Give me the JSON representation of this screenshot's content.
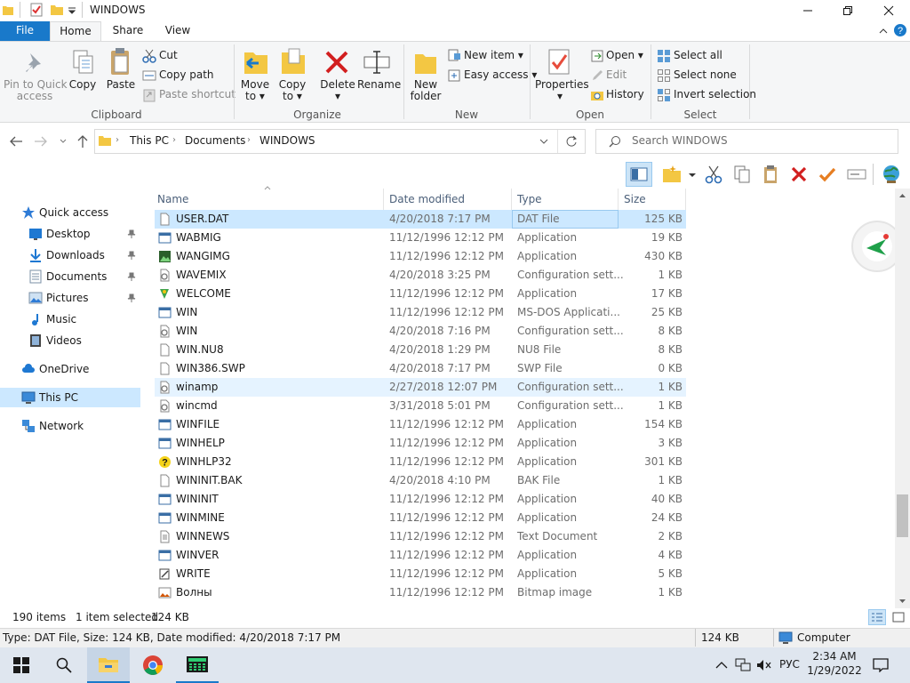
{
  "window": {
    "title": "WINDOWS"
  },
  "tabs": {
    "file": "File",
    "home": "Home",
    "share": "Share",
    "view": "View"
  },
  "ribbon": {
    "pin_line1": "Pin to Quick",
    "pin_line2": "access",
    "copy": "Copy",
    "paste": "Paste",
    "cut": "Cut",
    "copy_path": "Copy path",
    "paste_shortcut": "Paste shortcut",
    "clipboard": "Clipboard",
    "move_line1": "Move",
    "move_line2": "to",
    "copy_to_line1": "Copy",
    "copy_to_line2": "to",
    "delete": "Delete",
    "rename": "Rename",
    "organize": "Organize",
    "new_folder_line1": "New",
    "new_folder_line2": "folder",
    "new_item": "New item",
    "easy_access": "Easy access",
    "new": "New",
    "properties": "Properties",
    "open": "Open",
    "edit": "Edit",
    "history": "History",
    "open_group": "Open",
    "select_all": "Select all",
    "select_none": "Select none",
    "invert_selection": "Invert selection",
    "select_group": "Select"
  },
  "address": {
    "crumbs": [
      "This PC",
      "Documents",
      "WINDOWS"
    ],
    "search_placeholder": "Search WINDOWS"
  },
  "nav": {
    "quick_access": "Quick access",
    "desktop": "Desktop",
    "downloads": "Downloads",
    "documents": "Documents",
    "pictures": "Pictures",
    "music": "Music",
    "videos": "Videos",
    "onedrive": "OneDrive",
    "this_pc": "This PC",
    "network": "Network"
  },
  "columns": {
    "name": "Name",
    "date": "Date modified",
    "type": "Type",
    "size": "Size"
  },
  "files": [
    {
      "name": "USER.DAT",
      "date": "4/20/2018 7:17 PM",
      "type": "DAT File",
      "size": "125 KB",
      "icon": "blank-file-icon",
      "state": "selected"
    },
    {
      "name": "WABMIG",
      "date": "11/12/1996 12:12 PM",
      "type": "Application",
      "size": "19 KB",
      "icon": "app-icon",
      "state": ""
    },
    {
      "name": "WANGIMG",
      "date": "11/12/1996 12:12 PM",
      "type": "Application",
      "size": "430 KB",
      "icon": "image-app-icon",
      "state": ""
    },
    {
      "name": "WAVEMIX",
      "date": "4/20/2018 3:25 PM",
      "type": "Configuration sett...",
      "size": "1 KB",
      "icon": "config-file-icon",
      "state": ""
    },
    {
      "name": "WELCOME",
      "date": "11/12/1996 12:12 PM",
      "type": "Application",
      "size": "17 KB",
      "icon": "welcome-app-icon",
      "state": ""
    },
    {
      "name": "WIN",
      "date": "11/12/1996 12:12 PM",
      "type": "MS-DOS Applicati...",
      "size": "25 KB",
      "icon": "app-icon",
      "state": ""
    },
    {
      "name": "WIN",
      "date": "4/20/2018 7:16 PM",
      "type": "Configuration sett...",
      "size": "8 KB",
      "icon": "config-file-icon",
      "state": ""
    },
    {
      "name": "WIN.NU8",
      "date": "4/20/2018 1:29 PM",
      "type": "NU8 File",
      "size": "8 KB",
      "icon": "blank-file-icon",
      "state": ""
    },
    {
      "name": "WIN386.SWP",
      "date": "4/20/2018 7:17 PM",
      "type": "SWP File",
      "size": "0 KB",
      "icon": "blank-file-icon",
      "state": ""
    },
    {
      "name": "winamp",
      "date": "2/27/2018 12:07 PM",
      "type": "Configuration sett...",
      "size": "1 KB",
      "icon": "config-file-icon",
      "state": "hover"
    },
    {
      "name": "wincmd",
      "date": "3/31/2018 5:01 PM",
      "type": "Configuration sett...",
      "size": "1 KB",
      "icon": "config-file-icon",
      "state": ""
    },
    {
      "name": "WINFILE",
      "date": "11/12/1996 12:12 PM",
      "type": "Application",
      "size": "154 KB",
      "icon": "app-icon",
      "state": ""
    },
    {
      "name": "WINHELP",
      "date": "11/12/1996 12:12 PM",
      "type": "Application",
      "size": "3 KB",
      "icon": "app-icon",
      "state": ""
    },
    {
      "name": "WINHLP32",
      "date": "11/12/1996 12:12 PM",
      "type": "Application",
      "size": "301 KB",
      "icon": "help-app-icon",
      "state": ""
    },
    {
      "name": "WININIT.BAK",
      "date": "4/20/2018 4:10 PM",
      "type": "BAK File",
      "size": "1 KB",
      "icon": "blank-file-icon",
      "state": ""
    },
    {
      "name": "WININIT",
      "date": "11/12/1996 12:12 PM",
      "type": "Application",
      "size": "40 KB",
      "icon": "app-icon",
      "state": ""
    },
    {
      "name": "WINMINE",
      "date": "11/12/1996 12:12 PM",
      "type": "Application",
      "size": "24 KB",
      "icon": "app-icon",
      "state": ""
    },
    {
      "name": "WINNEWS",
      "date": "11/12/1996 12:12 PM",
      "type": "Text Document",
      "size": "2 KB",
      "icon": "text-file-icon",
      "state": ""
    },
    {
      "name": "WINVER",
      "date": "11/12/1996 12:12 PM",
      "type": "Application",
      "size": "4 KB",
      "icon": "app-icon",
      "state": ""
    },
    {
      "name": "WRITE",
      "date": "11/12/1996 12:12 PM",
      "type": "Application",
      "size": "5 KB",
      "icon": "write-app-icon",
      "state": ""
    },
    {
      "name": "Волны",
      "date": "11/12/1996 12:12 PM",
      "type": "Bitmap image",
      "size": "1 KB",
      "icon": "bitmap-file-icon",
      "state": ""
    }
  ],
  "status": {
    "items": "190 items",
    "selected": "1 item selected",
    "size": "124 KB"
  },
  "detail": {
    "text": "Type: DAT File, Size: 124 KB, Date modified: 4/20/2018 7:17 PM",
    "size": "124 KB",
    "location": "Computer"
  },
  "taskbar": {
    "time": "2:34 AM",
    "date": "1/29/2022",
    "lang": "РУС"
  }
}
